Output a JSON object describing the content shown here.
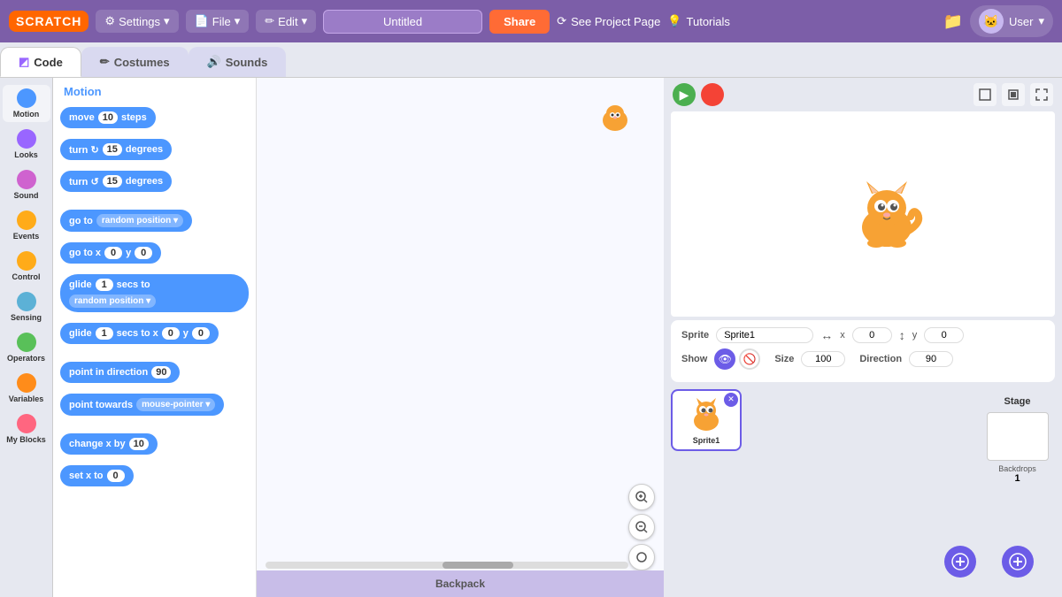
{
  "topNav": {
    "logo": "SCRATCH",
    "settings_label": "Settings",
    "file_label": "File",
    "edit_label": "Edit",
    "project_title": "Untitled",
    "share_label": "Share",
    "see_project_label": "See Project Page",
    "tutorials_label": "Tutorials",
    "user_label": "User"
  },
  "tabs": {
    "code_label": "Code",
    "costumes_label": "Costumes",
    "sounds_label": "Sounds"
  },
  "blockCategories": [
    {
      "id": "motion",
      "label": "Motion",
      "color": "#4c97ff"
    },
    {
      "id": "looks",
      "label": "Looks",
      "color": "#9966ff"
    },
    {
      "id": "sound",
      "label": "Sound",
      "color": "#cf63cf"
    },
    {
      "id": "events",
      "label": "Events",
      "color": "#ffab19"
    },
    {
      "id": "control",
      "label": "Control",
      "color": "#ffab19"
    },
    {
      "id": "sensing",
      "label": "Sensing",
      "color": "#5cb1d6"
    },
    {
      "id": "operators",
      "label": "Operators",
      "color": "#59c059"
    },
    {
      "id": "variables",
      "label": "Variables",
      "color": "#ff8c1a"
    },
    {
      "id": "myblocks",
      "label": "My Blocks",
      "color": "#ff6680"
    }
  ],
  "blocksPanelTitle": "Motion",
  "blocks": [
    {
      "id": "move",
      "template": "move {10} steps"
    },
    {
      "id": "turn_cw",
      "template": "turn ↻ {15} degrees"
    },
    {
      "id": "turn_ccw",
      "template": "turn ↺ {15} degrees"
    },
    {
      "id": "goto",
      "template": "go to [random position ▾]"
    },
    {
      "id": "goto_xy",
      "template": "go to x {0} y {0}"
    },
    {
      "id": "glide_random",
      "template": "glide {1} secs to [random position ▾]"
    },
    {
      "id": "glide_xy",
      "template": "glide {1} secs to x {0} y {0}"
    },
    {
      "id": "point_dir",
      "template": "point in direction {90}"
    },
    {
      "id": "point_towards",
      "template": "point towards [mouse-pointer ▾]"
    },
    {
      "id": "change_x",
      "template": "change x by {10}"
    },
    {
      "id": "set_x",
      "template": "set x to {0}"
    }
  ],
  "scripting": {
    "backpack_label": "Backpack"
  },
  "zoomControls": {
    "zoom_in": "+",
    "zoom_out": "−",
    "zoom_reset": "="
  },
  "stageControls": {
    "green_flag": "▶",
    "stop": "■"
  },
  "spriteInfo": {
    "sprite_label": "Sprite",
    "sprite_name": "Sprite1",
    "x_label": "x",
    "x_val": "0",
    "y_label": "y",
    "y_val": "0",
    "show_label": "Show",
    "size_label": "Size",
    "size_val": "100",
    "direction_label": "Direction",
    "direction_val": "90"
  },
  "spriteList": [
    {
      "id": "sprite1",
      "label": "Sprite1"
    }
  ],
  "stagePanel": {
    "title": "Stage",
    "backdrops_label": "Backdrops",
    "backdrops_count": "1"
  }
}
